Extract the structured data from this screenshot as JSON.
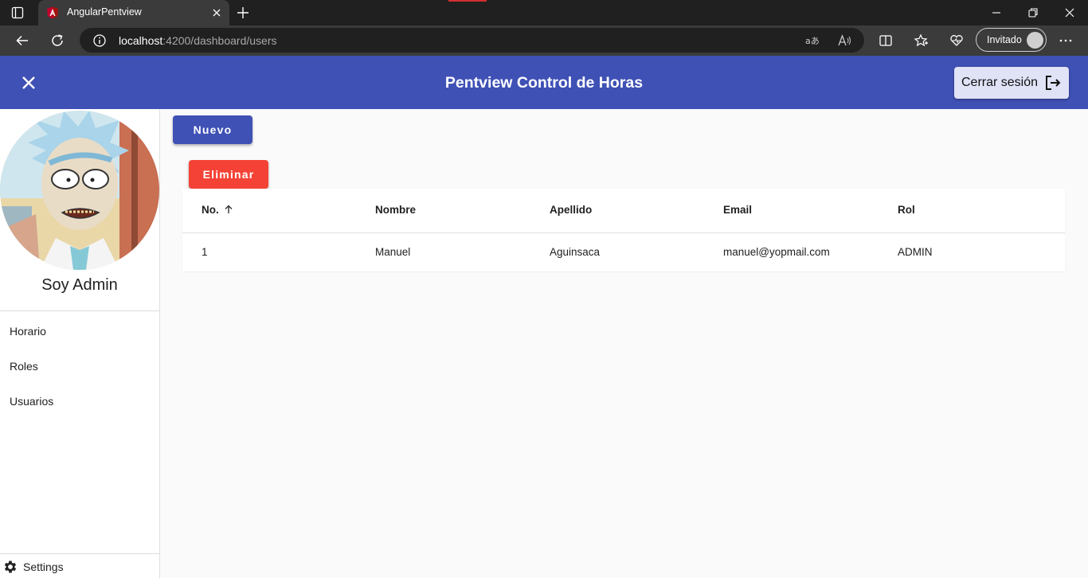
{
  "browser": {
    "tab_title": "AngularPentview",
    "url_host": "localhost",
    "url_path": ":4200/dashboard/users",
    "profile_label": "Invitado",
    "icons": [
      "sidebar-icon",
      "angular-icon",
      "close-icon",
      "plus-icon",
      "minimize-icon",
      "restore-icon",
      "close-window-icon",
      "back-icon",
      "reload-icon",
      "info-icon",
      "translate-icon",
      "read-aloud-icon",
      "split-screen-icon",
      "favorites-icon",
      "health-icon",
      "more-icon"
    ]
  },
  "toolbar": {
    "title": "Pentview Control de Horas",
    "logout_label": "Cerrar sesión",
    "accent": "#3f51b5"
  },
  "sidebar": {
    "user_name": "Soy Admin",
    "items": [
      {
        "label": "Horario"
      },
      {
        "label": "Roles"
      },
      {
        "label": "Usuarios"
      }
    ],
    "settings_label": "Settings"
  },
  "actions": {
    "new_label": "Nuevo",
    "delete_label": "Eliminar",
    "delete_color": "#f44336"
  },
  "table": {
    "headers": [
      "No.",
      "Nombre",
      "Apellido",
      "Email",
      "Rol"
    ],
    "sort_column": "No.",
    "sort_direction": "ascending",
    "rows": [
      [
        "1",
        "Manuel",
        "Aguinsaca",
        "manuel@yopmail.com",
        "ADMIN"
      ]
    ]
  }
}
